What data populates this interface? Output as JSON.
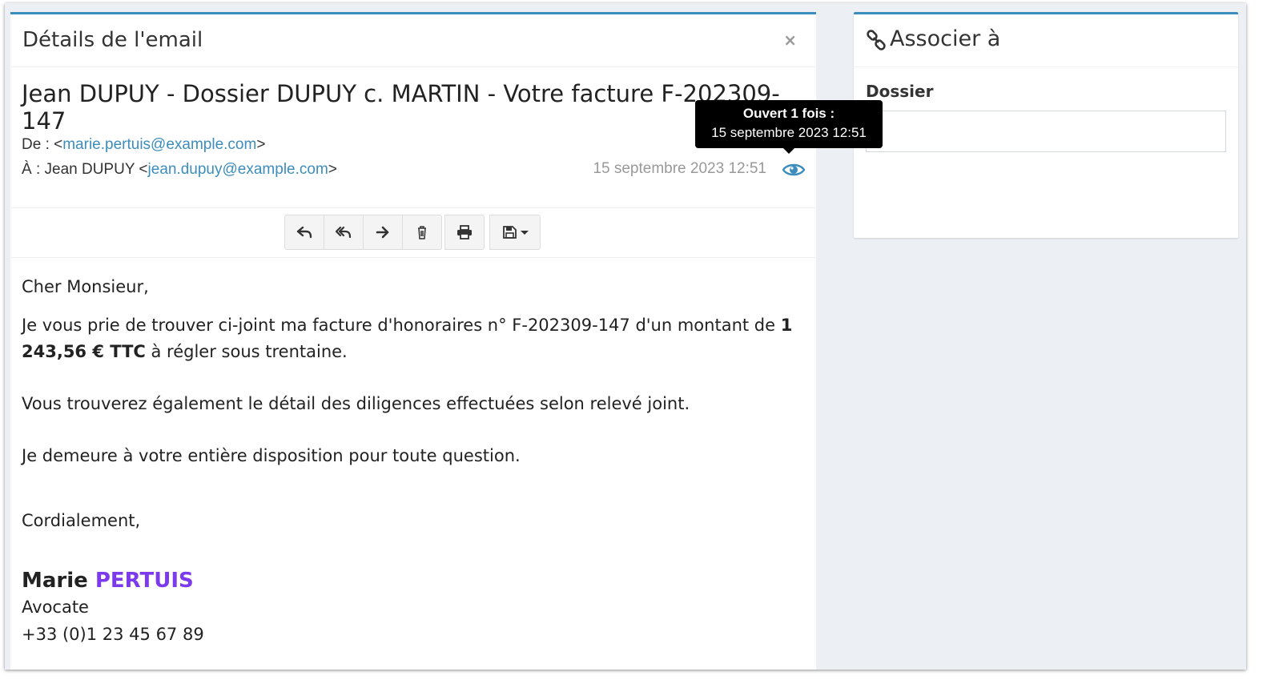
{
  "email_box": {
    "title": "Détails de l'email",
    "close_label": "×"
  },
  "mail": {
    "subject": "Jean DUPUY - Dossier DUPUY c. MARTIN - Votre facture F-202309-147",
    "from_prefix": "De : <",
    "from_email": "marie.pertuis@example.com",
    "from_suffix": ">",
    "to_prefix": "À : Jean DUPUY <",
    "to_email": "jean.dupuy@example.com",
    "to_suffix": ">",
    "date": "15 septembre 2023 12:51"
  },
  "tooltip": {
    "line1": "Ouvert 1 fois :",
    "line2": "15 septembre 2023 12:51"
  },
  "toolbar": {
    "icons": [
      "reply-icon",
      "reply-all-icon",
      "forward-icon",
      "trash-icon",
      "print-icon",
      "save-icon"
    ]
  },
  "body": {
    "greeting": "Cher Monsieur,",
    "p1_before": "Je vous prie de trouver ci-joint ma facture d'honoraires n° F-202309-147 d'un montant de ",
    "p1_bold": "1 243,56 € TTC",
    "p1_after": " à régler sous trentaine.",
    "p2": "Vous trouverez également le détail des diligences effectuées selon relevé joint.",
    "p3": "Je demeure à votre entière disposition pour toute question.",
    "closing": "Cordialement,",
    "sig_first": "Marie ",
    "sig_last": "PERTUIS",
    "sig_role": "Avocate",
    "sig_phone": "+33 (0)1 23 45 67 89"
  },
  "assoc": {
    "title": "Associer à",
    "label": "Dossier",
    "input_value": ""
  },
  "colors": {
    "accent": "#3c8dbc",
    "signature_last": "#7c3aed"
  }
}
